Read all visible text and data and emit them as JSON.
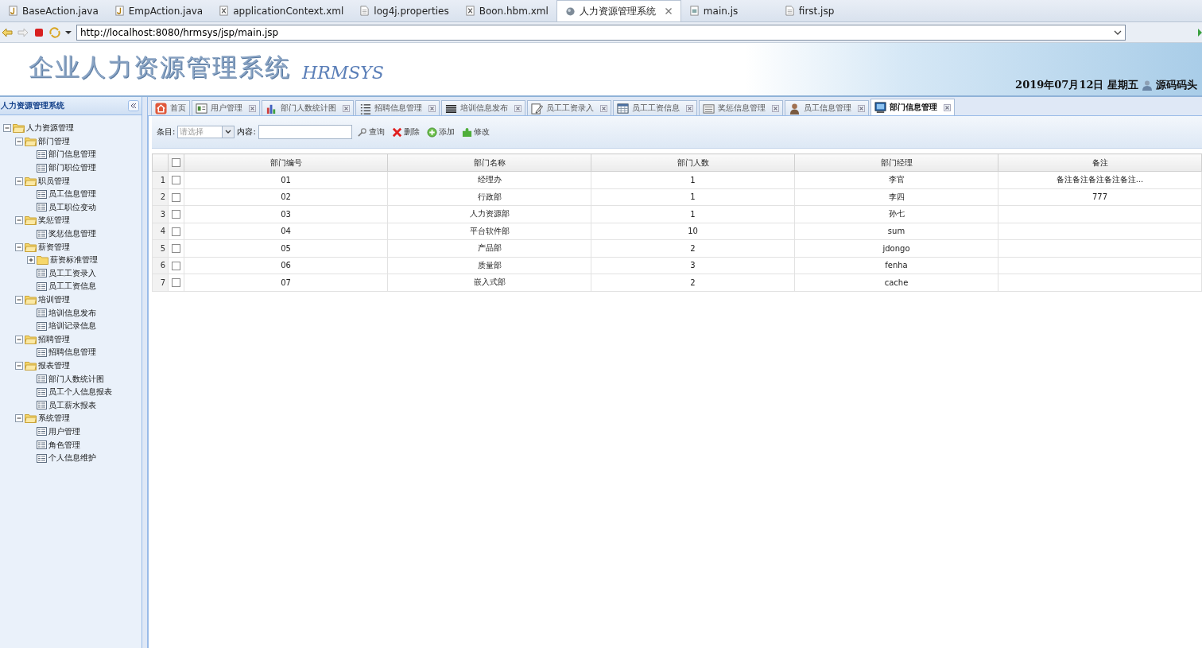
{
  "editor_tabs": [
    {
      "label": "BaseAction.java",
      "kind": "java",
      "selected": false
    },
    {
      "label": "EmpAction.java",
      "kind": "java",
      "selected": false
    },
    {
      "label": "applicationContext.xml",
      "kind": "xml",
      "selected": false
    },
    {
      "label": "log4j.properties",
      "kind": "file",
      "selected": false
    },
    {
      "label": "Boon.hbm.xml",
      "kind": "xml",
      "selected": false
    },
    {
      "label": "人力资源管理系统",
      "kind": "globe",
      "selected": true
    },
    {
      "label": "main.js",
      "kind": "js",
      "selected": false
    },
    {
      "label": "first.jsp",
      "kind": "file",
      "selected": false
    }
  ],
  "address_bar": {
    "url": "http://localhost:8080/hrmsys/jsp/main.jsp"
  },
  "header": {
    "title": "企业人力资源管理系统",
    "subtitle": "HRMSYS",
    "date": "2019年07月12日 星期五",
    "user": "源码码头"
  },
  "sidebar": {
    "title": "人力资源管理系统",
    "tree": [
      {
        "label": "人力资源管理",
        "kind": "folder",
        "expanded": true,
        "children": [
          {
            "label": "部门管理",
            "kind": "folder",
            "expanded": true,
            "children": [
              {
                "label": "部门信息管理",
                "kind": "page"
              },
              {
                "label": "部门职位管理",
                "kind": "page"
              }
            ]
          },
          {
            "label": "职员管理",
            "kind": "folder",
            "expanded": true,
            "children": [
              {
                "label": "员工信息管理",
                "kind": "page"
              },
              {
                "label": "员工职位变动",
                "kind": "page"
              }
            ]
          },
          {
            "label": "奖惩管理",
            "kind": "folder",
            "expanded": true,
            "children": [
              {
                "label": "奖惩信息管理",
                "kind": "page"
              }
            ]
          },
          {
            "label": "薪资管理",
            "kind": "folder",
            "expanded": true,
            "children": [
              {
                "label": "薪资标准管理",
                "kind": "folder",
                "expanded": false
              },
              {
                "label": "员工工资录入",
                "kind": "page"
              },
              {
                "label": "员工工资信息",
                "kind": "page"
              }
            ]
          },
          {
            "label": "培训管理",
            "kind": "folder",
            "expanded": true,
            "children": [
              {
                "label": "培训信息发布",
                "kind": "page"
              },
              {
                "label": "培训记录信息",
                "kind": "page"
              }
            ]
          },
          {
            "label": "招聘管理",
            "kind": "folder",
            "expanded": true,
            "children": [
              {
                "label": "招聘信息管理",
                "kind": "page"
              }
            ]
          },
          {
            "label": "报表管理",
            "kind": "folder",
            "expanded": true,
            "children": [
              {
                "label": "部门人数统计图",
                "kind": "page"
              },
              {
                "label": "员工个人信息报表",
                "kind": "page"
              },
              {
                "label": "员工薪水报表",
                "kind": "page"
              }
            ]
          },
          {
            "label": "系统管理",
            "kind": "folder",
            "expanded": true,
            "children": [
              {
                "label": "用户管理",
                "kind": "page"
              },
              {
                "label": "角色管理",
                "kind": "page"
              },
              {
                "label": "个人信息维护",
                "kind": "page"
              }
            ]
          }
        ]
      }
    ]
  },
  "tabs": [
    {
      "label": "首页",
      "kind": "home",
      "closable": false,
      "selected": false
    },
    {
      "label": "用户管理",
      "kind": "card",
      "closable": true,
      "selected": false
    },
    {
      "label": "部门人数统计图",
      "kind": "chart",
      "closable": true,
      "selected": false
    },
    {
      "label": "招聘信息管理",
      "kind": "list",
      "closable": true,
      "selected": false
    },
    {
      "label": "培训信息发布",
      "kind": "lines",
      "closable": true,
      "selected": false
    },
    {
      "label": "员工工资录入",
      "kind": "edit",
      "closable": true,
      "selected": false
    },
    {
      "label": "员工工资信息",
      "kind": "calendar",
      "closable": true,
      "selected": false
    },
    {
      "label": "奖惩信息管理",
      "kind": "form",
      "closable": true,
      "selected": false
    },
    {
      "label": "员工信息管理",
      "kind": "person",
      "closable": true,
      "selected": false
    },
    {
      "label": "部门信息管理",
      "kind": "monitor",
      "closable": true,
      "selected": true
    }
  ],
  "toolbar": {
    "field_label": "条目:",
    "select_placeholder": "请选择",
    "content_label": "内容:",
    "buttons": [
      {
        "label": "查询",
        "kind": "search"
      },
      {
        "label": "删除",
        "kind": "delete"
      },
      {
        "label": "添加",
        "kind": "add"
      },
      {
        "label": "修改",
        "kind": "puzzle"
      }
    ]
  },
  "table": {
    "all_checked": false,
    "columns": [
      "部门编号",
      "部门名称",
      "部门人数",
      "部门经理",
      "备注"
    ],
    "rows": [
      {
        "number": "1",
        "checked": false,
        "cells": [
          "01",
          "经理办",
          "1",
          "李官",
          "备注备注备注备注备注..."
        ]
      },
      {
        "number": "2",
        "checked": false,
        "cells": [
          "02",
          "行政部",
          "1",
          "李四",
          "777"
        ]
      },
      {
        "number": "3",
        "checked": false,
        "cells": [
          "03",
          "人力资源部",
          "1",
          "孙七",
          ""
        ]
      },
      {
        "number": "4",
        "checked": false,
        "cells": [
          "04",
          "平台软件部",
          "10",
          "sum",
          ""
        ]
      },
      {
        "number": "5",
        "checked": false,
        "cells": [
          "05",
          "产品部",
          "2",
          "jdongo",
          ""
        ]
      },
      {
        "number": "6",
        "checked": false,
        "cells": [
          "06",
          "质量部",
          "3",
          "fenha",
          ""
        ]
      },
      {
        "number": "7",
        "checked": false,
        "cells": [
          "07",
          "嵌入式部",
          "2",
          "cache",
          ""
        ]
      }
    ]
  }
}
